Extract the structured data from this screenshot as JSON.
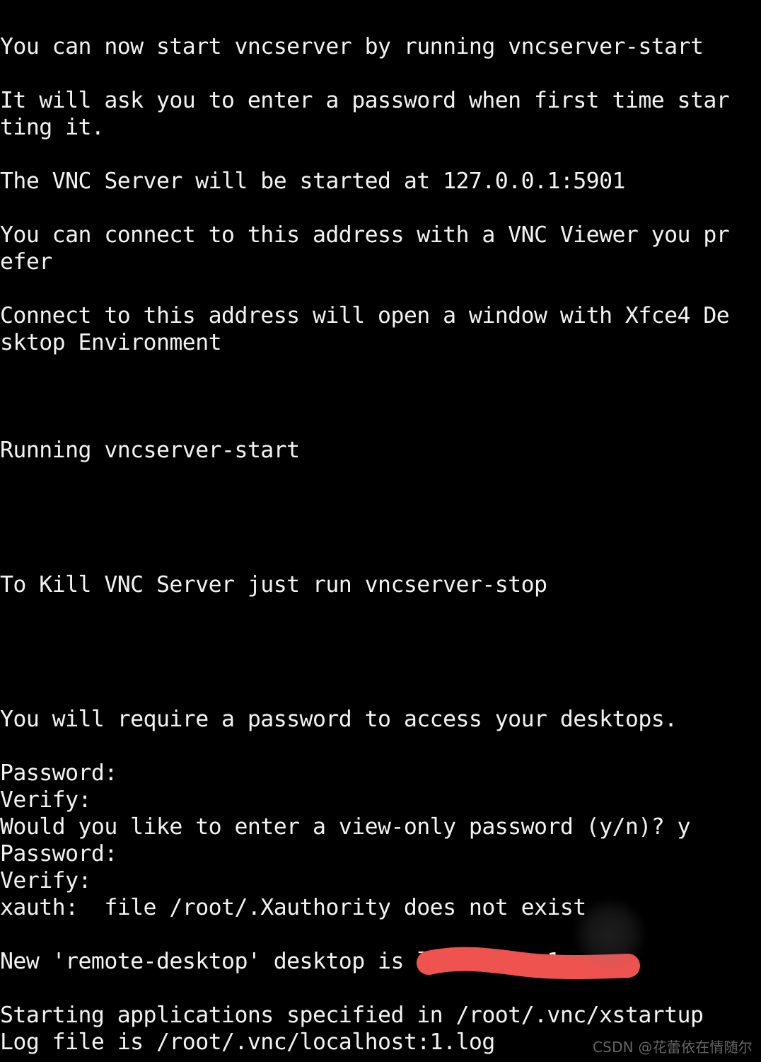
{
  "terminal": {
    "background_color": "#000000",
    "foreground_color": "#f2f2f2",
    "columns": 56,
    "lines": [
      "You can now start vncserver by running vncserver-start",
      "",
      "It will ask you to enter a password when first time star",
      "ting it.",
      "",
      "The VNC Server will be started at 127.0.0.1:5901",
      "",
      "You can connect to this address with a VNC Viewer you pr",
      "efer",
      "",
      "Connect to this address will open a window with Xfce4 De",
      "sktop Environment",
      "",
      "",
      "",
      "Running vncserver-start",
      "",
      "",
      "",
      "",
      "To Kill VNC Server just run vncserver-stop",
      "",
      "",
      "",
      "",
      "You will require a password to access your desktops.",
      "",
      "Password:",
      "Verify:",
      "Would you like to enter a view-only password (y/n)? y",
      "Password:",
      "Verify:",
      "xauth:  file /root/.Xauthority does not exist",
      "",
      "New 'remote-desktop' desktop is localhost:1",
      "",
      "Starting applications specified in /root/.vnc/xstartup",
      "Log file is /root/.vnc/localhost:1.log"
    ]
  },
  "annotation": {
    "name": "red-underline-stroke",
    "color": "#ef5350",
    "underlines_text": "localhost:1",
    "stroke_width": 34
  },
  "artifact": {
    "name": "grey-smudge",
    "color": "#8a8a8a"
  },
  "watermark": {
    "text": "CSDN @花蕾依在情随尔",
    "color": "#6e6e6e"
  }
}
